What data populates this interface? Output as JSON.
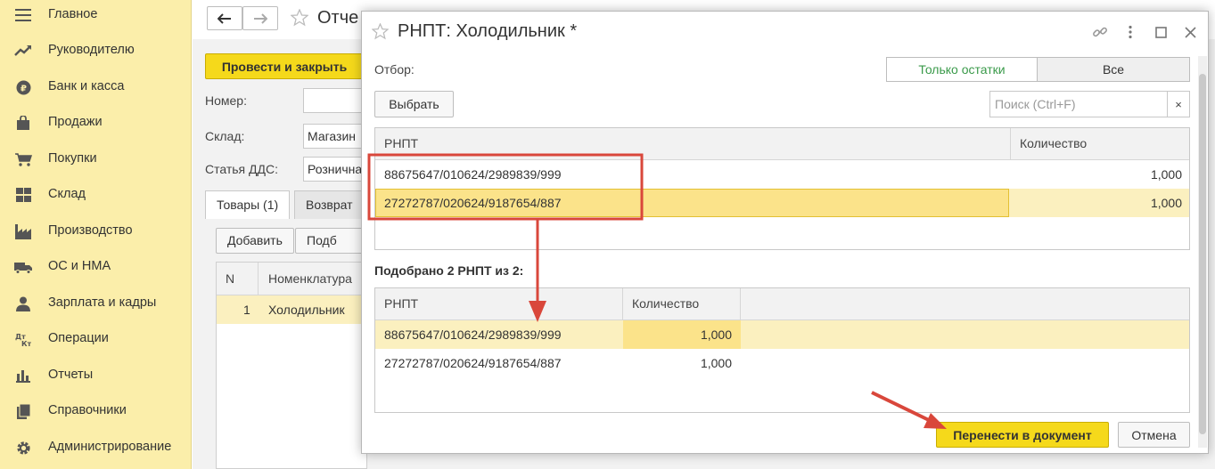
{
  "sidebar": {
    "items": [
      {
        "label": "Главное",
        "icon": "menu-lines-icon"
      },
      {
        "label": "Руководителю",
        "icon": "trend-arrow-icon"
      },
      {
        "label": "Банк и касса",
        "icon": "ruble-coin-icon"
      },
      {
        "label": "Продажи",
        "icon": "shopping-bag-icon"
      },
      {
        "label": "Покупки",
        "icon": "shopping-cart-icon"
      },
      {
        "label": "Склад",
        "icon": "warehouse-boxes-icon"
      },
      {
        "label": "Производство",
        "icon": "factory-icon"
      },
      {
        "label": "ОС и НМА",
        "icon": "truck-icon"
      },
      {
        "label": "Зарплата и кадры",
        "icon": "person-icon"
      },
      {
        "label": "Операции",
        "icon": "dt-kt-icon"
      },
      {
        "label": "Отчеты",
        "icon": "bar-chart-icon"
      },
      {
        "label": "Справочники",
        "icon": "books-icon"
      },
      {
        "label": "Администрирование",
        "icon": "gear-icon"
      }
    ]
  },
  "document": {
    "title": "Отче",
    "post_close_label": "Провести и закрыть",
    "fields": [
      {
        "label": "Номер:",
        "value": ""
      },
      {
        "label": "Склад:",
        "value": "Магазин"
      },
      {
        "label": "Статья ДДС:",
        "value": "Рознична"
      }
    ],
    "tabs": [
      "Товары (1)",
      "Возврат"
    ],
    "buttons": {
      "add": "Добавить",
      "pick": "Подб"
    },
    "grid": {
      "headers": [
        "N",
        "Номенклатура"
      ],
      "rows": [
        {
          "n": "1",
          "name": "Холодильник"
        }
      ]
    }
  },
  "dialog": {
    "title": "РНПТ: Холодильник *",
    "filter_label": "Отбор:",
    "filter_options": [
      "Только остатки",
      "Все"
    ],
    "filter_selected": "Только остатки",
    "select_button": "Выбрать",
    "search_placeholder": "Поиск (Ctrl+F)",
    "search_clear": "×",
    "available": {
      "headers": [
        "РНПТ",
        "Количество"
      ],
      "rows": [
        {
          "rnpt": "88675647/010624/2989839/999",
          "qty": "1,000"
        },
        {
          "rnpt": "27272787/020624/9187654/887",
          "qty": "1,000"
        }
      ]
    },
    "picked_label": "Подобрано 2 РНПТ из 2:",
    "picked": {
      "headers": [
        "РНПТ",
        "Количество"
      ],
      "rows": [
        {
          "rnpt": "88675647/010624/2989839/999",
          "qty": "1,000"
        },
        {
          "rnpt": "27272787/020624/9187654/887",
          "qty": "1,000"
        }
      ]
    },
    "transfer_button": "Перенести в документ",
    "cancel_button": "Отмена"
  },
  "colors": {
    "sidebar_bg": "#fbeeaa",
    "accent_yellow": "#f5d91b",
    "row_highlight": "#fbf0bf",
    "cell_highlight": "#fbe38a",
    "green_text": "#3a9a4a",
    "annotation_red": "#d9473b"
  }
}
